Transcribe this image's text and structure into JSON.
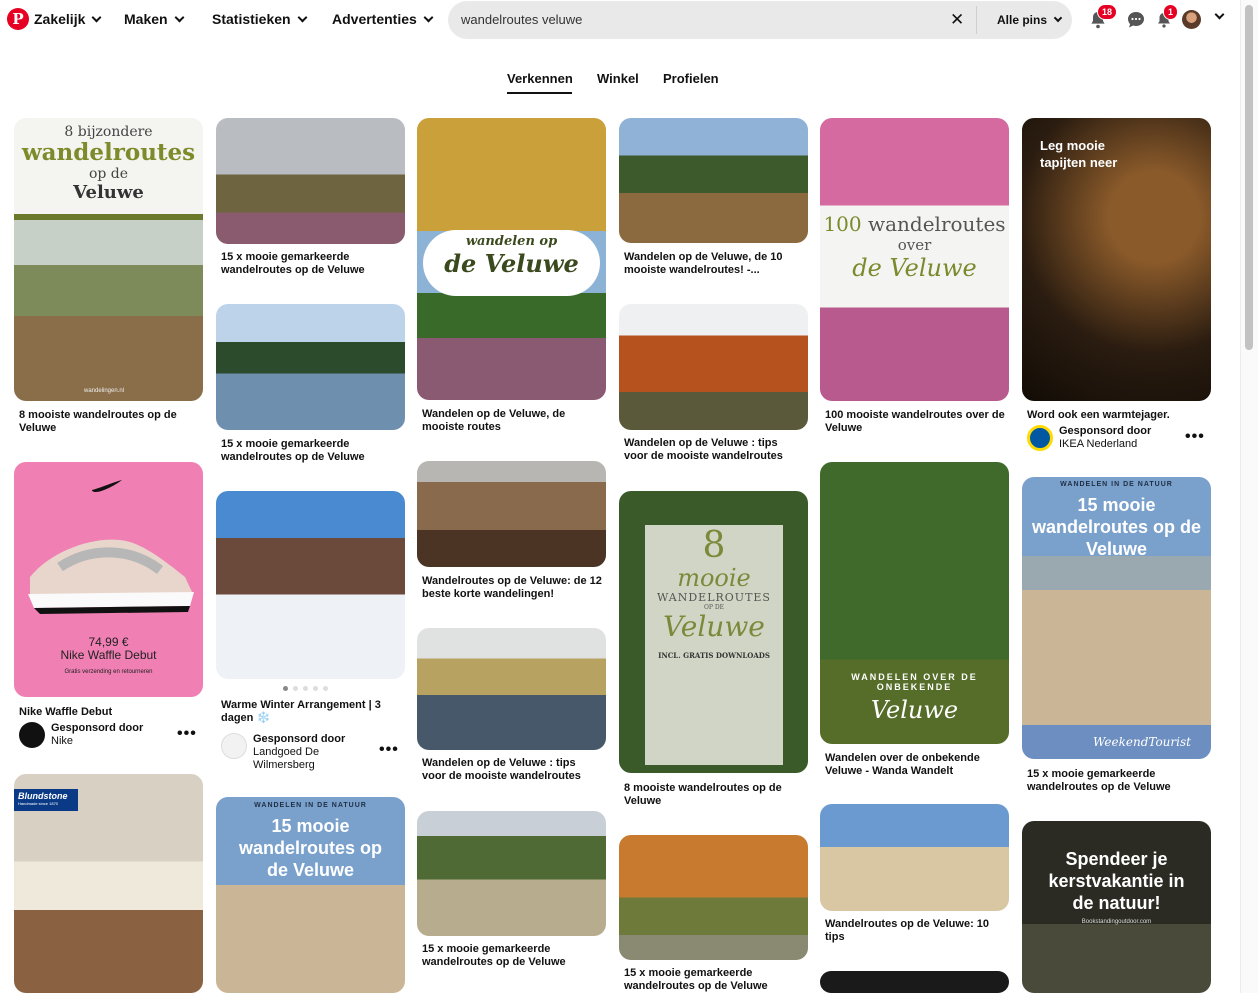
{
  "header": {
    "logo": "P",
    "nav": [
      "Zakelijk",
      "Maken",
      "Statistieken",
      "Advertenties"
    ],
    "search_value": "wandelroutes veluwe",
    "search_clear": "✕",
    "search_scope": "Alle pins",
    "notifications_badge": "18",
    "updates_badge": "1"
  },
  "tabs": [
    "Verkennen",
    "Winkel",
    "Profielen"
  ],
  "pins": {
    "p1": {
      "title_small": "8 bijzondere",
      "title_big": "wandelroutes",
      "title_mid": "op de",
      "title_end": "Veluwe",
      "source": "wandelingen.nl",
      "caption": "8 mooiste wandelroutes op de Veluwe"
    },
    "p2": {
      "caption": "Nike Waffle Debut",
      "price": "74,99 €",
      "product": "Nike Waffle Debut",
      "shipping": "Gratis verzending en retourneren",
      "sponsored": "Gesponsord door",
      "brand": "Nike"
    },
    "p3": {
      "brand_tag": "Blundstone",
      "brand_sub": "Handmade since 1870"
    },
    "p4": {
      "caption": "15 x mooie gemarkeerde wandelroutes op de Veluwe"
    },
    "p5": {
      "caption": "15 x mooie gemarkeerde wandelroutes op de Veluwe"
    },
    "p6": {
      "caption": "Warme Winter Arrangement | 3 dagen ❄️",
      "sponsored": "Gesponsord door",
      "brand": "Landgoed De Wilmersberg"
    },
    "p7": {
      "top": "WANDELEN IN DE NATUUR",
      "title": "15 mooie wandelroutes op de Veluwe"
    },
    "p8": {
      "title_small": "wandelen op",
      "title_big": "de Veluwe",
      "caption": "Wandelen op de Veluwe, de mooiste routes"
    },
    "p9": {
      "caption": "Wandelroutes op de Veluwe: de 12 beste korte wandelingen!"
    },
    "p10": {
      "caption": "Wandelen op de Veluwe : tips voor de mooiste wandelroutes"
    },
    "p11": {
      "caption": "15 x mooie gemarkeerde wandelroutes op de Veluwe"
    },
    "p12": {
      "caption": "Wandelen op de Veluwe, de 10 mooiste wandelroutes! -..."
    },
    "p13": {
      "caption": "Wandelen op de Veluwe : tips voor de mooiste wandelroutes"
    },
    "p14": {
      "num": "8",
      "title": "mooie",
      "sub": "WANDELROUTES",
      "sub2": "OP DE",
      "script": "Veluwe",
      "dl": "INCL. GRATIS DOWNLOADS",
      "caption": "8 mooiste wandelroutes op de Veluwe"
    },
    "p15": {
      "caption": "15 x mooie gemarkeerde wandelroutes op de Veluwe"
    },
    "p16": {
      "title_num": "100",
      "title": "wandelroutes",
      "mid": "over",
      "script": "de Veluwe",
      "caption": "100 mooiste wandelroutes over de Veluwe"
    },
    "p17": {
      "top": "WANDELEN OVER DE ONBEKENDE",
      "script": "Veluwe",
      "caption": "Wandelen over de onbekende Veluwe - Wanda Wandelt"
    },
    "p18": {
      "caption": "Wandelroutes op de Veluwe: 10 tips"
    },
    "p19": {
      "overlay": "Leg mooie tapijten neer",
      "caption": "Word ook een warmtejager.",
      "sponsored": "Gesponsord door",
      "brand": "IKEA Nederland"
    },
    "p20": {
      "top": "WANDELEN IN DE NATUUR",
      "title": "15 mooie wandelroutes op de Veluwe",
      "logo": "WeekendTourist",
      "caption": "15 x mooie gemarkeerde wandelroutes op de Veluwe"
    },
    "p21": {
      "overlay": "Spendeer je kerstvakantie in de natuur!",
      "source": "Bookstandingoutdoor.com"
    }
  },
  "colors": {
    "brand": "#e60023",
    "search_bg": "#e9e9e9"
  }
}
